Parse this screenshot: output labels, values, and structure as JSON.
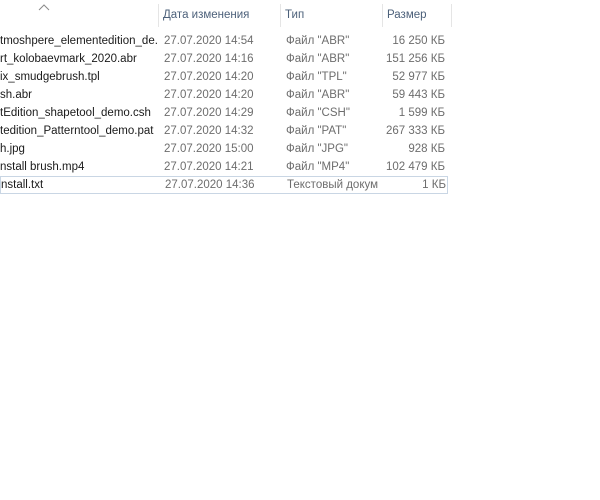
{
  "columns": {
    "date": "Дата изменения",
    "type": "Тип",
    "size": "Размер"
  },
  "sort_icon": "chevron-up-icon",
  "files": [
    {
      "name": "tmoshpere_elementedition_de...",
      "date": "27.07.2020 14:54",
      "type": "Файл \"ABR\"",
      "size": "16 250 КБ"
    },
    {
      "name": "rt_kolobaevmark_2020.abr",
      "date": "27.07.2020 14:16",
      "type": "Файл \"ABR\"",
      "size": "151 256 КБ"
    },
    {
      "name": "ix_smudgebrush.tpl",
      "date": "27.07.2020 14:20",
      "type": "Файл \"TPL\"",
      "size": "52 977 КБ"
    },
    {
      "name": "sh.abr",
      "date": "27.07.2020 14:20",
      "type": "Файл \"ABR\"",
      "size": "59 443 КБ"
    },
    {
      "name": "tEdition_shapetool_demo.csh",
      "date": "27.07.2020 14:29",
      "type": "Файл \"CSH\"",
      "size": "1 599 КБ"
    },
    {
      "name": "tedition_Patterntool_demo.pat",
      "date": "27.07.2020 14:32",
      "type": "Файл \"PAT\"",
      "size": "267 333 КБ"
    },
    {
      "name": "h.jpg",
      "date": "27.07.2020 15:00",
      "type": "Файл \"JPG\"",
      "size": "928 КБ"
    },
    {
      "name": "nstall brush.mp4",
      "date": "27.07.2020 14:21",
      "type": "Файл \"MP4\"",
      "size": "102 479 КБ"
    },
    {
      "name": "nstall.txt",
      "date": "27.07.2020 14:36",
      "type": "Текстовый докум...",
      "size": "1 КБ"
    }
  ]
}
